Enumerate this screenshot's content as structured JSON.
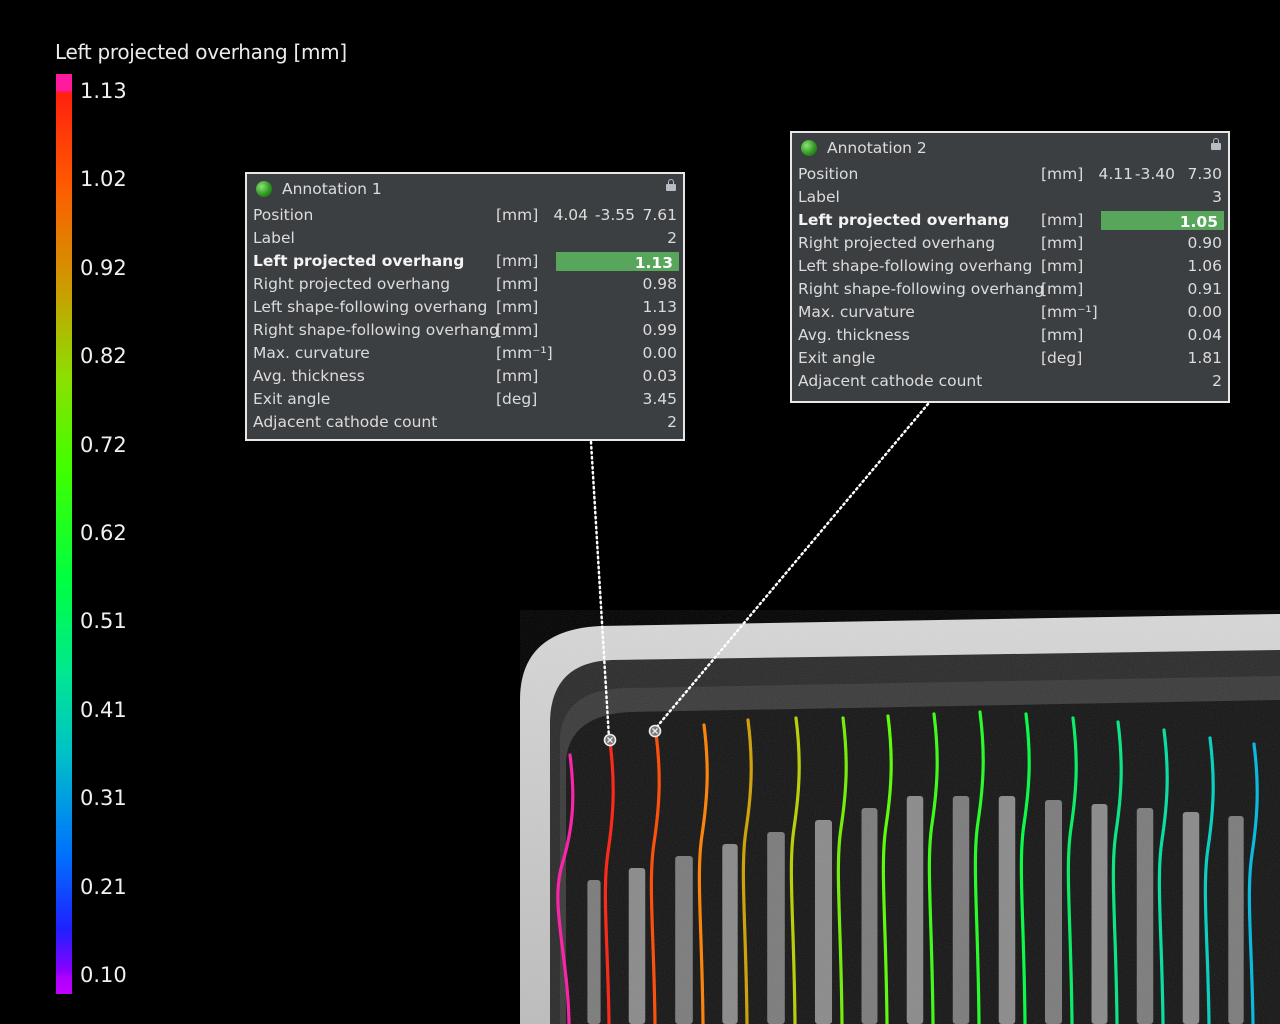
{
  "scale": {
    "title": "Left projected overhang [mm]",
    "ticks": [
      "1.13",
      "1.02",
      "0.92",
      "0.82",
      "0.72",
      "0.62",
      "0.51",
      "0.41",
      "0.31",
      "0.21",
      "0.10"
    ]
  },
  "annotations": [
    {
      "title": "Annotation 1",
      "position_unit": "[mm]",
      "position": [
        "7.61",
        "-3.55",
        "4.04"
      ],
      "rows": [
        {
          "label": "Label",
          "unit": "",
          "value": "2"
        },
        {
          "label": "Left projected overhang",
          "unit": "[mm]",
          "value": "1.13",
          "highlight": true
        },
        {
          "label": "Right projected overhang",
          "unit": "[mm]",
          "value": "0.98"
        },
        {
          "label": "Left shape-following overhang",
          "unit": "[mm]",
          "value": "1.13"
        },
        {
          "label": "Right shape-following overhang",
          "unit": "[mm]",
          "value": "0.99"
        },
        {
          "label": "Max. curvature",
          "unit": "[mm⁻¹]",
          "value": "0.00"
        },
        {
          "label": "Avg. thickness",
          "unit": "[mm]",
          "value": "0.03"
        },
        {
          "label": "Exit angle",
          "unit": "[deg]",
          "value": "3.45"
        },
        {
          "label": "Adjacent cathode count",
          "unit": "",
          "value": "2"
        }
      ]
    },
    {
      "title": "Annotation 2",
      "position_unit": "[mm]",
      "position": [
        "7.30",
        "-3.40",
        "4.11"
      ],
      "rows": [
        {
          "label": "Label",
          "unit": "",
          "value": "3"
        },
        {
          "label": "Left projected overhang",
          "unit": "[mm]",
          "value": "1.05",
          "highlight": true
        },
        {
          "label": "Right projected overhang",
          "unit": "[mm]",
          "value": "0.90"
        },
        {
          "label": "Left shape-following overhang",
          "unit": "[mm]",
          "value": "1.06"
        },
        {
          "label": "Right shape-following overhang",
          "unit": "[mm]",
          "value": "0.91"
        },
        {
          "label": "Max. curvature",
          "unit": "[mm⁻¹]",
          "value": "0.00"
        },
        {
          "label": "Avg. thickness",
          "unit": "[mm]",
          "value": "0.04"
        },
        {
          "label": "Exit angle",
          "unit": "[deg]",
          "value": "1.81"
        },
        {
          "label": "Adjacent cathode count",
          "unit": "",
          "value": "2"
        }
      ]
    }
  ],
  "colors": {
    "panel_bg": "#3c3f42",
    "panel_border": "#e8e8e8",
    "highlight": "#57a65b",
    "background": "#000000"
  }
}
